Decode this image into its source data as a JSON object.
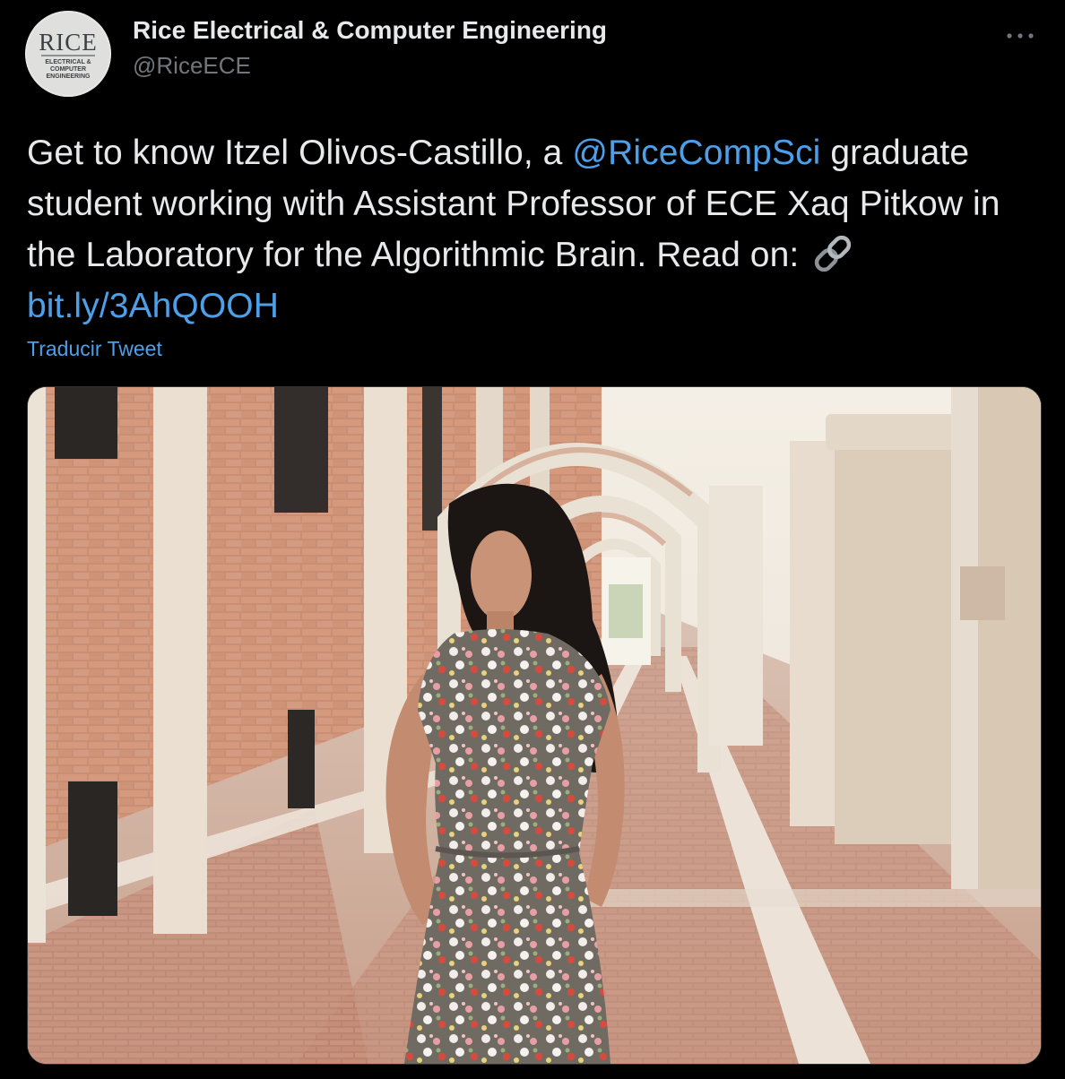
{
  "tweet": {
    "author": {
      "display_name": "Rice Electrical & Computer Engineering",
      "handle": "@RiceECE",
      "avatar": {
        "logo_word": "RICE",
        "logo_line1": "ELECTRICAL &",
        "logo_line2": "COMPUTER",
        "logo_line3": "ENGINEERING"
      }
    },
    "more_icon": "ellipsis-icon",
    "text": {
      "part1": "Get to know Itzel Olivos-Castillo, a ",
      "mention": "@RiceCompSci",
      "part2": " graduate student working with Assistant Professor of ECE Xaq Pitkow in the Laboratory for the Algorithmic Brain. Read on: ",
      "link_icon": "link-emoji-icon",
      "link": "bit.ly/3AhQOOH"
    },
    "translate_label": "Traducir Tweet",
    "media": {
      "kind": "photo",
      "icon": "photo-icon"
    }
  },
  "colors": {
    "background": "#000000",
    "text": "#e7e9ea",
    "secondary": "#71767b",
    "accent": "#4ca0ea"
  }
}
